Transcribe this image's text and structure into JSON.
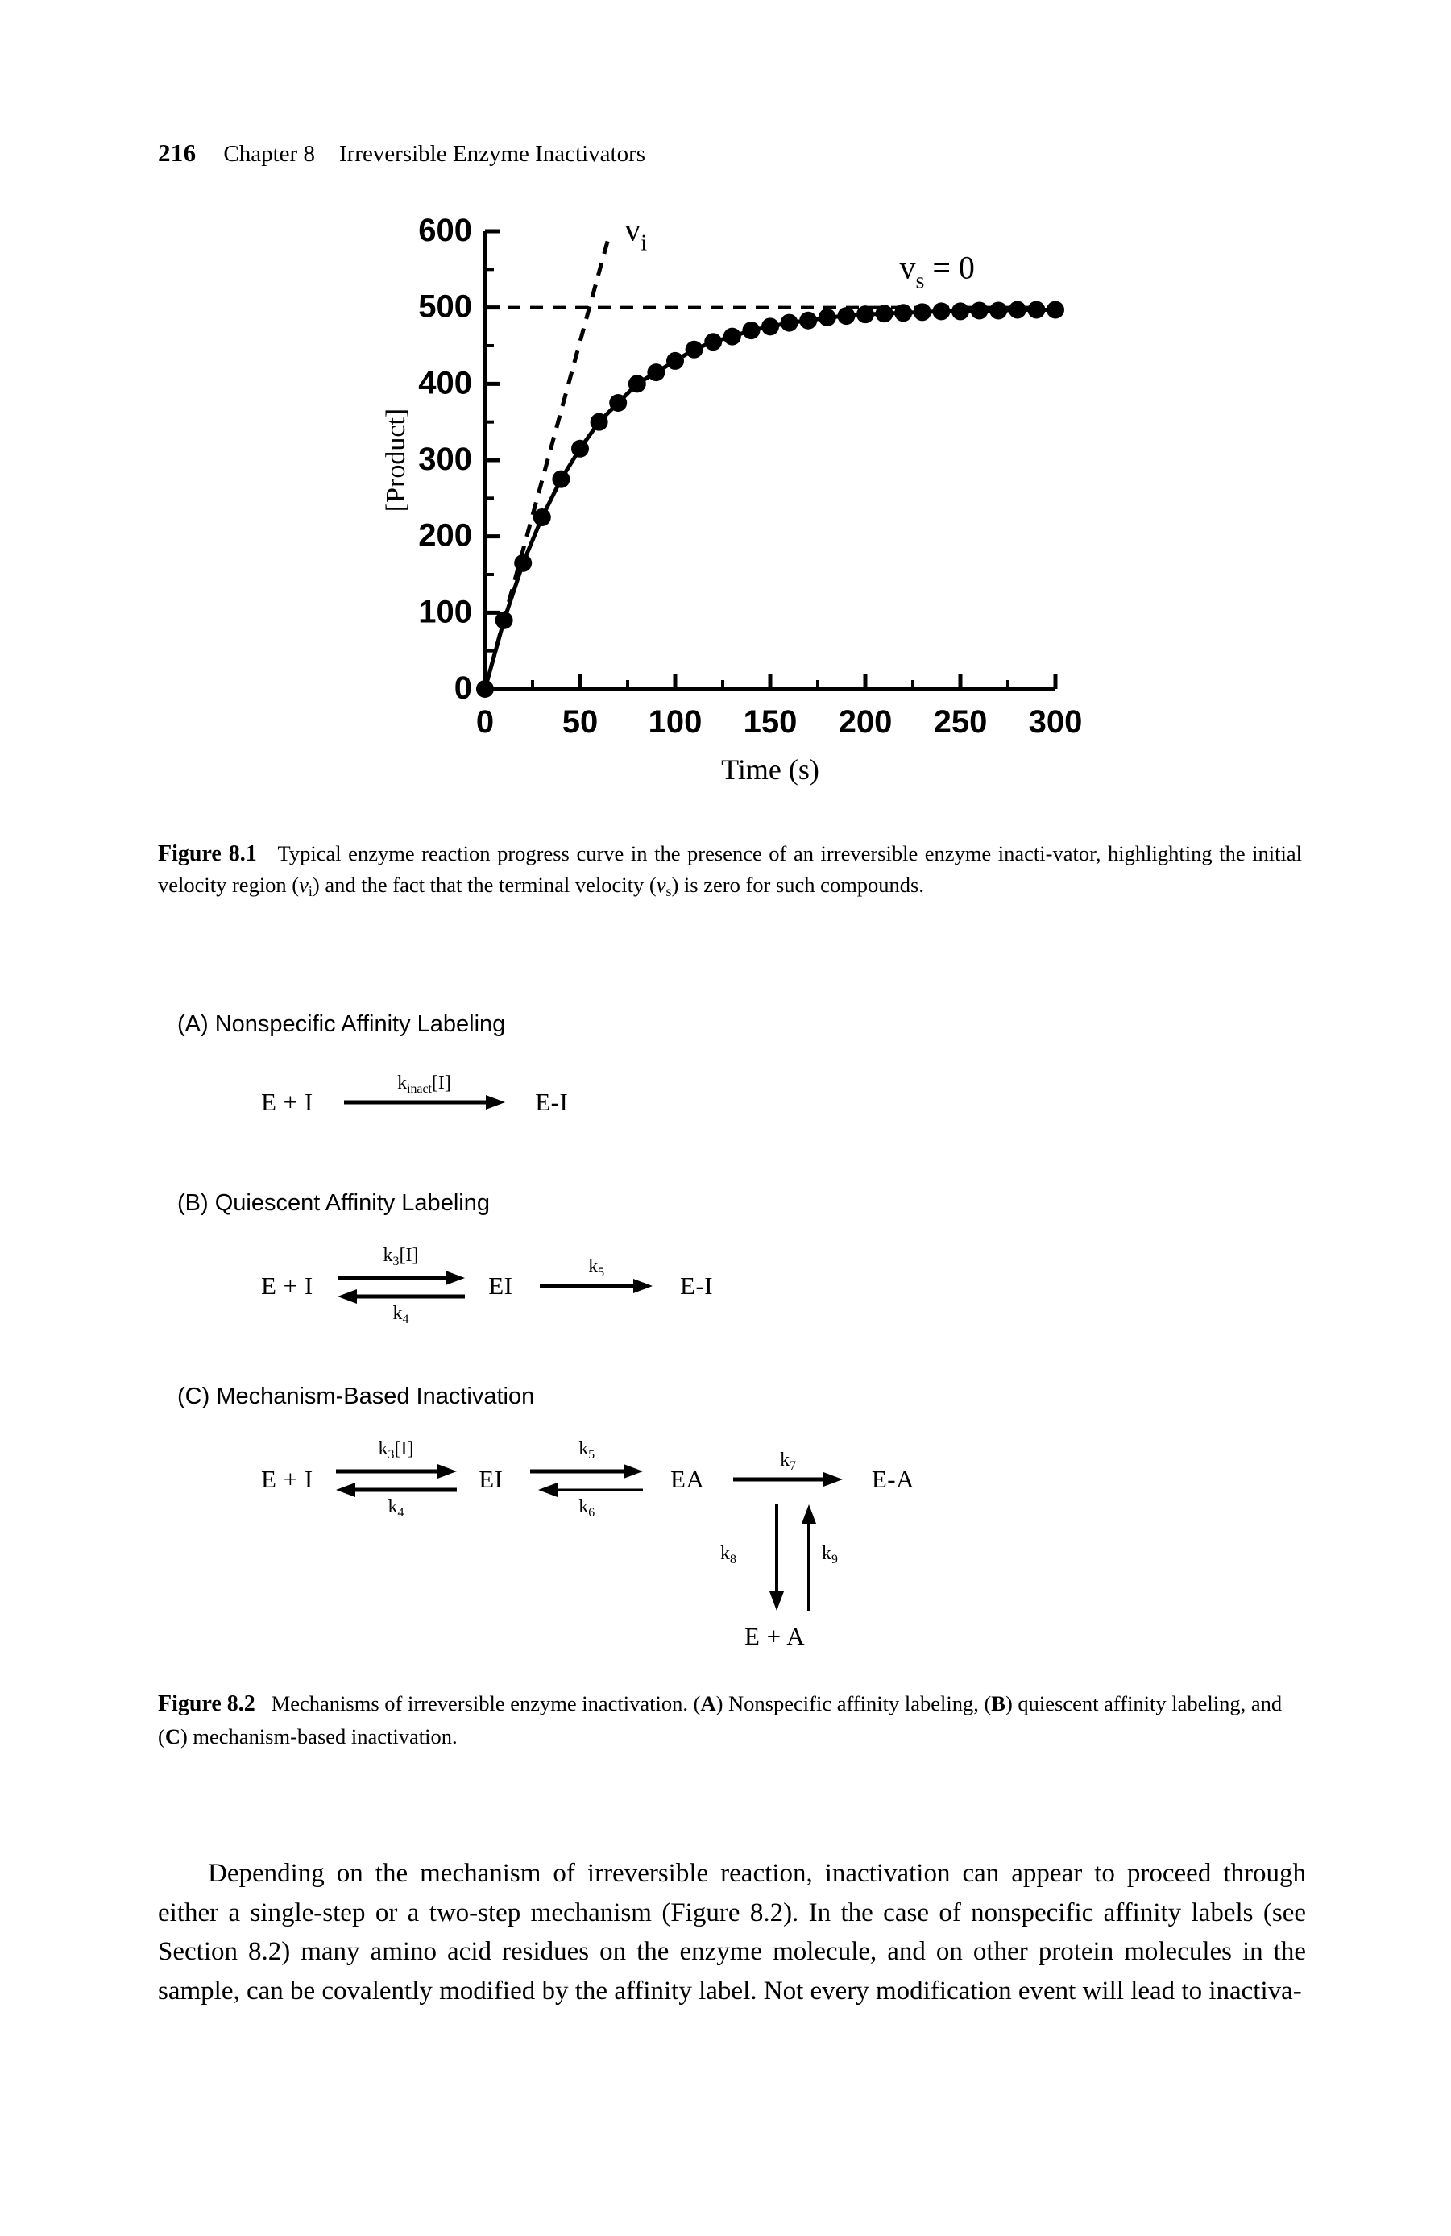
{
  "running_head": {
    "folio": "216",
    "chapter": "Chapter 8",
    "title": "Irreversible Enzyme Inactivators"
  },
  "figure_8_1": {
    "caption_label": "Figure 8.1",
    "caption_text_1": "Typical enzyme reaction progress curve in the presence of an irreversible enzyme inacti-vator, highlighting the initial velocity region (",
    "caption_vi": "v",
    "caption_vi_sub": "i",
    "caption_text_2": ") and the fact that the terminal velocity (",
    "caption_vs": "v",
    "caption_vs_sub": "s",
    "caption_text_3": ") is zero for such compounds.",
    "annotation_vi": "v",
    "annotation_vi_sub": "i",
    "annotation_vs": "v",
    "annotation_vs_sub": "s",
    "annotation_vs_eq": " = 0"
  },
  "chart_data": {
    "type": "line",
    "title": "",
    "xlabel": "Time (s)",
    "ylabel": "[Product]",
    "xlim": [
      0,
      300
    ],
    "ylim": [
      0,
      600
    ],
    "x_ticks": [
      0,
      50,
      100,
      150,
      200,
      250,
      300
    ],
    "y_ticks": [
      0,
      100,
      200,
      300,
      400,
      500,
      600
    ],
    "x_minor_interval": 25,
    "y_minor_interval": 50,
    "grid": false,
    "legend": "none",
    "marker": "filled-circle",
    "series": [
      {
        "name": "progress curve",
        "x": [
          0,
          10,
          20,
          30,
          40,
          50,
          60,
          70,
          80,
          90,
          100,
          110,
          120,
          130,
          140,
          150,
          160,
          170,
          180,
          190,
          200,
          210,
          220,
          230,
          240,
          250,
          260,
          270,
          280,
          290,
          300
        ],
        "values": [
          0,
          90,
          165,
          225,
          275,
          315,
          350,
          375,
          400,
          415,
          430,
          445,
          455,
          462,
          470,
          475,
          480,
          483,
          487,
          489,
          491,
          492,
          493,
          494,
          495,
          495,
          496,
          496,
          497,
          497,
          497
        ]
      }
    ],
    "annotations": [
      {
        "name": "initial-velocity-tangent",
        "style": "dashed",
        "from": [
          0,
          0
        ],
        "to": [
          65,
          592
        ],
        "slope": 9.1,
        "label": "vi"
      },
      {
        "name": "terminal-plateau-line",
        "style": "dashed",
        "y": 500,
        "from_x": 0,
        "to_x": 300,
        "label": "vs = 0"
      }
    ]
  },
  "figure_8_2": {
    "panel_a": {
      "heading": "(A)  Nonspecific Affinity Labeling",
      "reactant": "E + I",
      "rate_k": "k",
      "rate_sub": "inact",
      "rate_tail": "[I]",
      "product": "E-I"
    },
    "panel_b": {
      "heading": "(B) Quiescent Affinity Labeling",
      "reactant": "E + I",
      "forward_k": "k",
      "forward_sub": "3",
      "forward_tail": "[I]",
      "reverse_k": "k",
      "reverse_sub": "4",
      "intermediate": "EI",
      "second_k": "k",
      "second_sub": "5",
      "product": "E-I"
    },
    "panel_c": {
      "heading": "(C)  Mechanism-Based Inactivation",
      "reactant": "E + I",
      "forward_k": "k",
      "forward_sub": "3",
      "forward_tail": "[I]",
      "reverse_k": "k",
      "reverse_sub": "4",
      "intermediate": "EI",
      "second_fwd_k": "k",
      "second_fwd_sub": "5",
      "second_rev_k": "k",
      "second_rev_sub": "6",
      "adduct": "EA",
      "third_k": "k",
      "third_sub": "7",
      "product": "E-A",
      "down_k": "k",
      "down_sub": "8",
      "up_k": "k",
      "up_sub": "9",
      "release": "E + A"
    },
    "caption_label": "Figure 8.2",
    "caption_text_1": "Mechanisms of irreversible enzyme inactivation. (",
    "caption_a": "A",
    "caption_text_2": ") Nonspecific affinity labeling, (",
    "caption_b": "B",
    "caption_text_3": ") quiescent affinity labeling, and (",
    "caption_c": "C",
    "caption_text_4": ") mechanism-based inactivation."
  },
  "body": {
    "paragraph": "Depending on the mechanism of irreversible reaction, inactivation can appear to proceed through either a single-step or a two-step mechanism (Figure 8.2). In the case of nonspecific affinity labels (see Section 8.2) many amino acid residues on the enzyme molecule, and on other protein molecules in the sample, can be covalently modified by the affinity label. Not every modification event will lead to inactiva-"
  },
  "colors": {
    "ink": "#000000",
    "paper": "#ffffff"
  }
}
